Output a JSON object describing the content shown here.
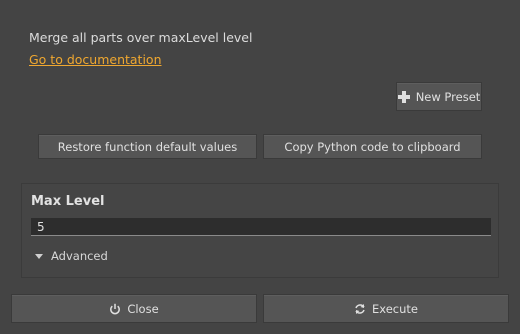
{
  "header": {
    "description": "Merge all parts over maxLevel level",
    "doc_link": "Go to documentation"
  },
  "presets": {
    "new_preset_label": "New Preset",
    "new_preset_icon": "plus-icon"
  },
  "actions": {
    "restore_label": "Restore function default values",
    "copy_label": "Copy Python code to clipboard"
  },
  "parameters": {
    "max_level": {
      "label": "Max Level",
      "value": "5"
    },
    "advanced_label": "Advanced"
  },
  "footer": {
    "close_label": "Close",
    "close_icon": "power-icon",
    "execute_label": "Execute",
    "execute_icon": "refresh-icon"
  },
  "colors": {
    "background": "#444444",
    "link": "#f0a830",
    "button": "#555555"
  }
}
